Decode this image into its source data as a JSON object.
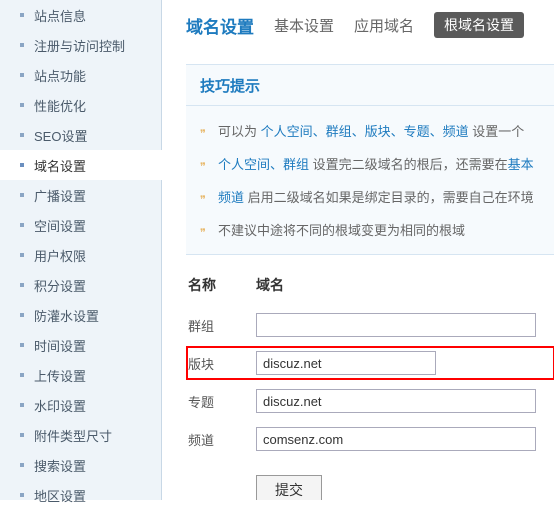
{
  "sidebar": {
    "items": [
      {
        "label": "站点信息"
      },
      {
        "label": "注册与访问控制"
      },
      {
        "label": "站点功能"
      },
      {
        "label": "性能优化"
      },
      {
        "label": "SEO设置"
      },
      {
        "label": "域名设置"
      },
      {
        "label": "广播设置"
      },
      {
        "label": "空间设置"
      },
      {
        "label": "用户权限"
      },
      {
        "label": "积分设置"
      },
      {
        "label": "防灌水设置"
      },
      {
        "label": "时间设置"
      },
      {
        "label": "上传设置"
      },
      {
        "label": "水印设置"
      },
      {
        "label": "附件类型尺寸"
      },
      {
        "label": "搜索设置"
      },
      {
        "label": "地区设置"
      }
    ],
    "active_index": 5
  },
  "tabs": {
    "main": "域名设置",
    "items": [
      "基本设置",
      "应用域名"
    ],
    "pill": "根域名设置"
  },
  "tips": {
    "header": "技巧提示",
    "rows": [
      {
        "pre": "可以为 ",
        "em": "个人空间、群组、版块、专题、频道",
        "post": " 设置一个"
      },
      {
        "pre": "",
        "em": "个人空间、群组",
        "post": " 设置完二级域名的根后，还需要在"
      },
      {
        "pre": "",
        "em": "基本",
        "post2": ""
      },
      {
        "pre": "",
        "em": "频道",
        "post": " 启用二级域名如果是绑定目录的，需要自己在环境"
      },
      {
        "pre": "不建议中途将不同的根域变更为相同的根域",
        "em": "",
        "post": ""
      }
    ]
  },
  "form": {
    "head_name": "名称",
    "head_domain": "域名",
    "rows": [
      {
        "label": "群组",
        "value": ""
      },
      {
        "label": "版块",
        "value": "discuz.net"
      },
      {
        "label": "专题",
        "value": "discuz.net"
      },
      {
        "label": "频道",
        "value": "comsenz.com"
      }
    ],
    "submit": "提交"
  }
}
